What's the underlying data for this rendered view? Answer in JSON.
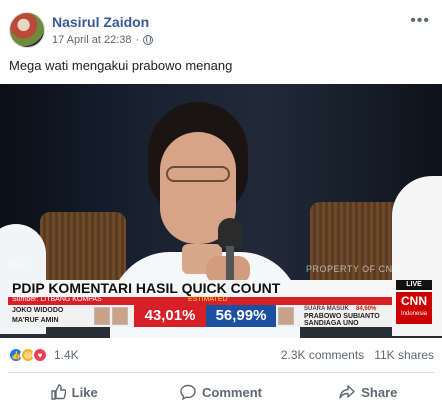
{
  "post": {
    "author": "Nasirul Zaidon",
    "timestamp": "17 April at 22:38",
    "privacy_icon": "globe-icon",
    "more_icon": "more-options-icon",
    "caption": "Mega wati mengakui prabowo menang"
  },
  "media": {
    "headline": "PDIP KOMENTARI HASIL QUICK COUNT",
    "subline": "Sumber: LITBANG KOMPAS",
    "subline_right": "ESTIMATED",
    "left_pair": [
      "JOKO WIDODO",
      "MA'RUF AMIN"
    ],
    "right_pair": [
      "PRABOWO SUBIANTO",
      "SANDIAGA UNO"
    ],
    "left_pct": "43,01%",
    "right_pct": "56,99%",
    "vote_label": "SUARA MASUK",
    "vote_value": "84,60%",
    "live_label": "LIVE",
    "network": "CNN",
    "network_sub": "Indonesia",
    "watermark": "PROPERTY OF CNN",
    "corner_text": "R-BO"
  },
  "stats": {
    "reaction_icons": [
      "like-reaction-icon",
      "haha-reaction-icon",
      "love-reaction-icon"
    ],
    "reactions": "1.4K",
    "comments": "2.3K comments",
    "shares": "11K shares"
  },
  "actions": {
    "like": "Like",
    "comment": "Comment",
    "share": "Share"
  },
  "colors": {
    "name_link": "#385898",
    "like_blue": "#1877f2",
    "cnn_red": "#cc0000"
  }
}
